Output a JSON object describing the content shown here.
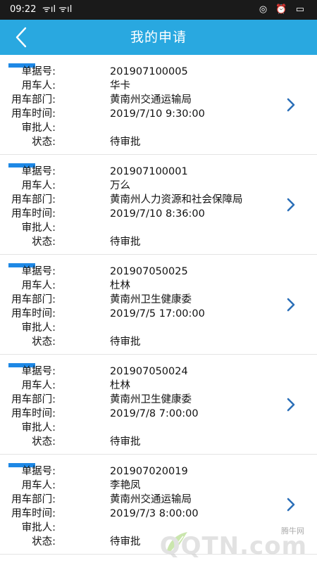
{
  "status_bar": {
    "time": "09:22",
    "signal": "ᯤıl ᯤıl",
    "icons_right": "◎ ⏰ ▭"
  },
  "header": {
    "title": "我的申请",
    "back_icon": "chevron-left-icon"
  },
  "labels": {
    "doc_no": "单据号:",
    "user": "用车人:",
    "dept": "用车部门:",
    "time": "用车时间:",
    "approver": "审批人:",
    "status": "状态:"
  },
  "records": [
    {
      "doc_no": "201907100005",
      "user": "华卡",
      "dept": "黄南州交通运输局",
      "time": "2019/7/10 9:30:00",
      "approver": "",
      "status": "待审批"
    },
    {
      "doc_no": "201907100001",
      "user": "万么",
      "dept": "黄南州人力资源和社会保障局",
      "time": "2019/7/10 8:36:00",
      "approver": "",
      "status": "待审批"
    },
    {
      "doc_no": "201907050025",
      "user": "杜林",
      "dept": "黄南州卫生健康委",
      "time": "2019/7/5 17:00:00",
      "approver": "",
      "status": "待审批"
    },
    {
      "doc_no": "201907050024",
      "user": "杜林",
      "dept": "黄南州卫生健康委",
      "time": "2019/7/8 7:00:00",
      "approver": "",
      "status": "待审批"
    },
    {
      "doc_no": "201907020019",
      "user": "李艳凤",
      "dept": "黄南州交通运输局",
      "time": "2019/7/3 8:00:00",
      "approver": "",
      "status": "待审批"
    }
  ],
  "watermark": {
    "cn": "腾牛网",
    "en": "QQTN.com"
  },
  "colors": {
    "header_bg": "#29a8e0",
    "marker": "#1e88e5",
    "chevron": "#2b6fb8",
    "status_bar_bg": "#1a1a1a"
  }
}
